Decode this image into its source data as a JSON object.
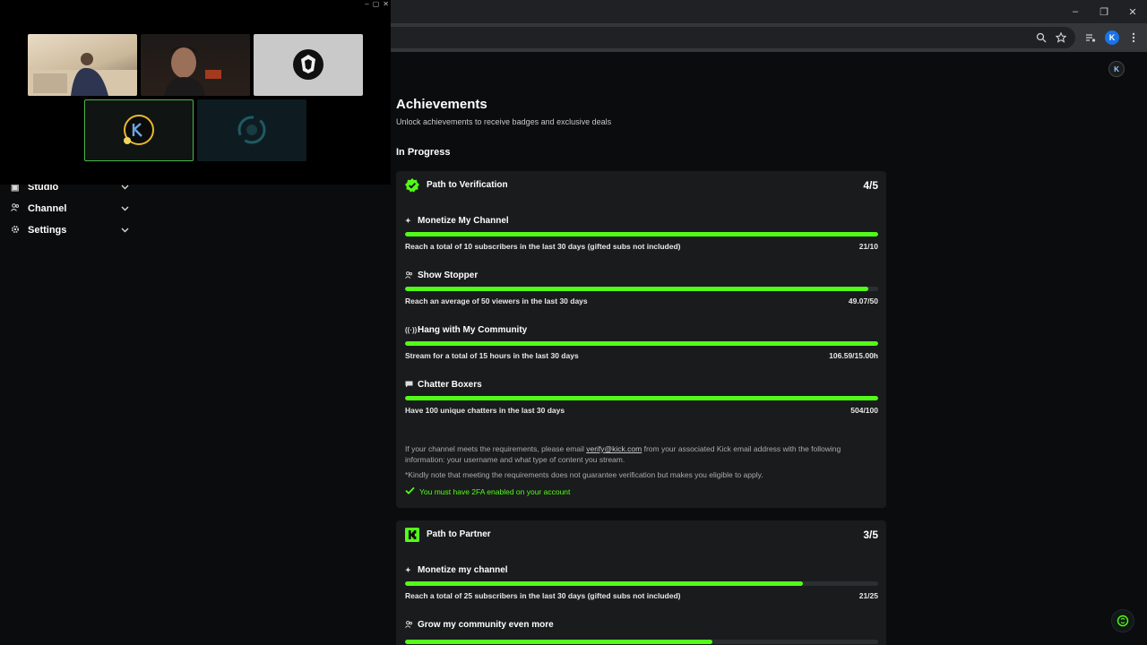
{
  "browser": {
    "window_controls": {
      "minimize": "–",
      "restore": "❐",
      "close": "✕"
    },
    "avatar_letter": "K"
  },
  "sidebar": {
    "items": [
      {
        "label": "Studio",
        "icon": "studio-icon"
      },
      {
        "label": "Channel",
        "icon": "users-icon"
      },
      {
        "label": "Settings",
        "icon": "gear-icon"
      }
    ]
  },
  "pip": {
    "controls": [
      "–",
      "▢",
      "✕"
    ]
  },
  "page": {
    "title": "Achievements",
    "subtitle": "Unlock achievements to receive badges and exclusive deals",
    "section": "In Progress"
  },
  "verification": {
    "title": "Path to Verification",
    "count": "4/5",
    "goals": [
      {
        "title": "Monetize My Channel",
        "icon": "sparkle-icon",
        "desc": "Reach a total of 10 subscribers in the last 30 days (gifted subs not included)",
        "value": "21/10",
        "progress": 1.0
      },
      {
        "title": "Show Stopper",
        "icon": "users-icon",
        "desc": "Reach an average of 50 viewers in the last 30 days",
        "value": "49.07/50",
        "progress": 0.98
      },
      {
        "title": "Hang with My Community",
        "icon": "broadcast-icon",
        "desc": "Stream for a total of 15 hours in the last 30 days",
        "value": "106.59/15.00h",
        "progress": 1.0
      },
      {
        "title": "Chatter Boxers",
        "icon": "chat-icon",
        "desc": "Have 100 unique chatters in the last 30 days",
        "value": "504/100",
        "progress": 1.0
      }
    ],
    "note_before_link": "If your channel meets the requirements, please email ",
    "note_link": "verify@kick.com",
    "note_after_link": " from your associated Kick email address with the following information: your username and what type of content you stream.",
    "disclaimer": "*Kindly note that meeting the requirements does not guarantee verification but makes you eligible to apply.",
    "requirement": "You must have 2FA enabled on your account"
  },
  "partner": {
    "title": "Path to Partner",
    "count": "3/5",
    "goals": [
      {
        "title": "Monetize my channel",
        "icon": "sparkle-icon",
        "desc": "Reach a total of 25 subscribers in the last 30 days (gifted subs not included)",
        "value": "21/25",
        "progress": 0.84
      },
      {
        "title": "Grow my community even more",
        "icon": "users-icon",
        "progress": 0.65
      }
    ]
  },
  "colors": {
    "accent": "#53fc18",
    "card": "#191b1c",
    "background": "#0b0c0d"
  }
}
